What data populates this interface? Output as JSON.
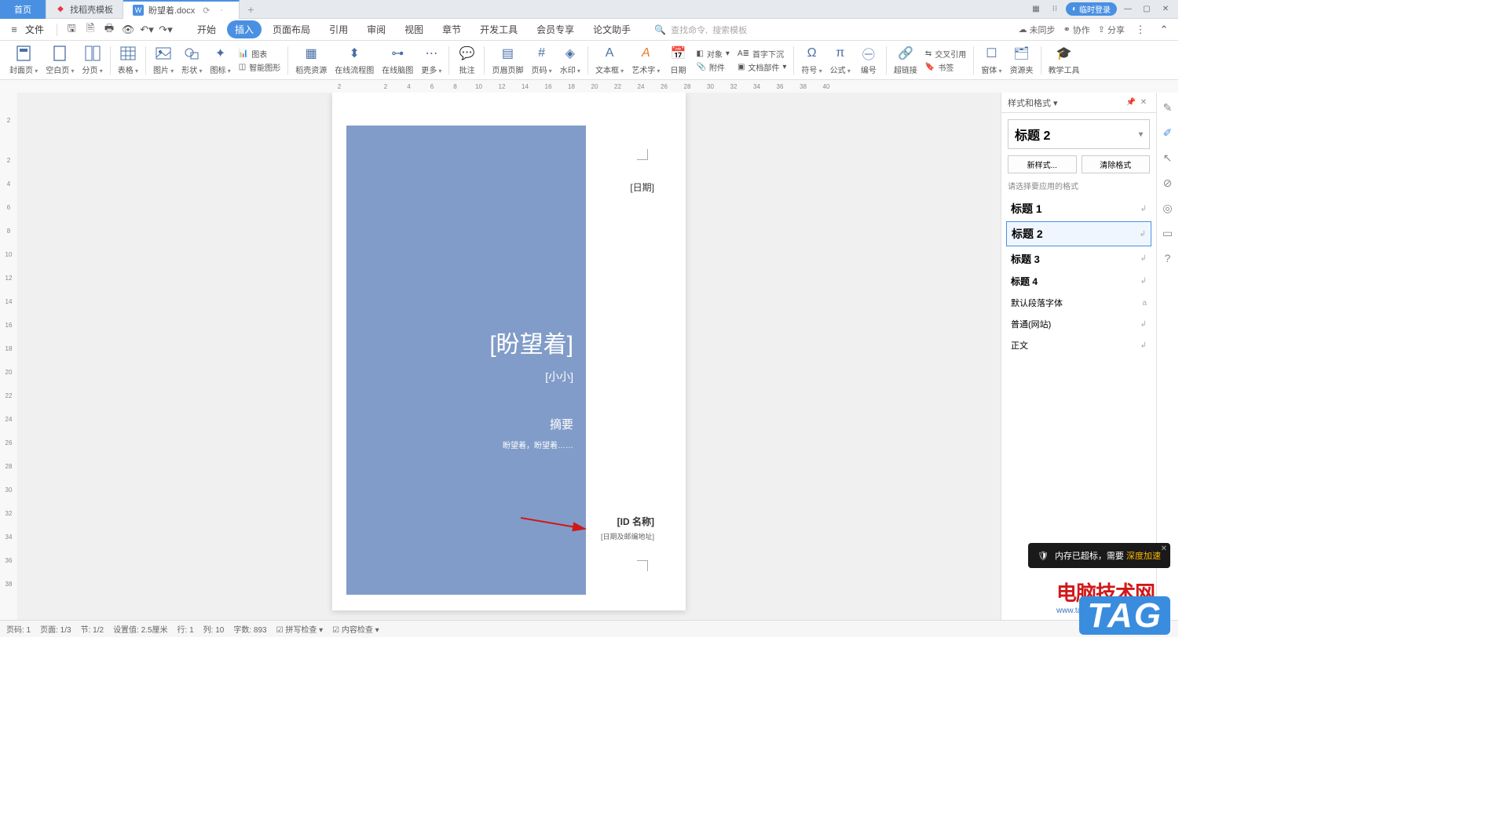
{
  "tabs": {
    "home": "首页",
    "t1": "找稻壳模板",
    "t2": "盼望着.docx"
  },
  "window": {
    "login": "临时登录"
  },
  "menubar": {
    "file": "文件",
    "tabs": [
      "开始",
      "插入",
      "页面布局",
      "引用",
      "审阅",
      "视图",
      "章节",
      "开发工具",
      "会员专享",
      "论文助手"
    ],
    "active_index": 1,
    "search_cmd": "查找命令,",
    "search_tpl": "搜索模板"
  },
  "right_actions": {
    "unsync": "未同步",
    "coop": "协作",
    "share": "分享"
  },
  "ribbon": {
    "cover": "封面页",
    "blank": "空白页",
    "break": "分页",
    "table": "表格",
    "pic": "图片",
    "shape": "形状",
    "icon": "图标",
    "chart": "图表",
    "smart": "智能图形",
    "daoke": "稻壳资源",
    "flow": "在线流程图",
    "mind": "在线脑图",
    "more": "更多",
    "comment": "批注",
    "header": "页眉页脚",
    "pageno": "页码",
    "watermark": "水印",
    "textbox": "文本框",
    "wordart": "艺术字",
    "date": "日期",
    "obj": "对象",
    "attach": "附件",
    "dropcap": "首字下沉",
    "docpart": "文档部件",
    "symbol": "符号",
    "formula": "公式",
    "number": "编号",
    "hyperlink": "超链接",
    "crossref": "交叉引用",
    "bookmark": "书签",
    "window": "窗体",
    "resource": "资源夹",
    "teach": "教学工具"
  },
  "ruler_h": [
    "2",
    "",
    "2",
    "4",
    "6",
    "8",
    "10",
    "12",
    "14",
    "16",
    "18",
    "20",
    "22",
    "24",
    "26",
    "28",
    "30",
    "32",
    "34",
    "36",
    "38",
    "40"
  ],
  "ruler_v": [
    "",
    "2",
    "",
    "2",
    "4",
    "6",
    "8",
    "10",
    "12",
    "14",
    "16",
    "18",
    "20",
    "22",
    "24",
    "26",
    "28",
    "30",
    "32",
    "34",
    "36",
    "38"
  ],
  "doc": {
    "date": "[日期]",
    "title": "[盼望着]",
    "subtitle": "[小小]",
    "abstract_h": "摘要",
    "abstract_b": "盼望着，盼望着……",
    "id_name": "[ID 名称]",
    "addr": "[日期及邮编地址]"
  },
  "styles_panel": {
    "title": "样式和格式",
    "current": "标题 2",
    "new_btn": "新样式...",
    "clear_btn": "清除格式",
    "hint": "请选择要应用的格式",
    "items": [
      {
        "name": "标题 1",
        "cls": ""
      },
      {
        "name": "标题 2",
        "cls": "",
        "selected": true
      },
      {
        "name": "标题 3",
        "cls": "h3"
      },
      {
        "name": "标题 4",
        "cls": "h4"
      },
      {
        "name": "默认段落字体",
        "cls": "normal",
        "mark": "a"
      },
      {
        "name": "普通(网站)",
        "cls": "normal"
      },
      {
        "name": "正文",
        "cls": "normal"
      }
    ]
  },
  "status": {
    "pg": "页码: 1",
    "pages": "页面: 1/3",
    "sec": "节: 1/2",
    "pos": "设置值: 2.5厘米",
    "line": "行: 1",
    "col": "列: 10",
    "words": "字数: 893",
    "spell": "拼写检查",
    "content": "内容检查"
  },
  "toast": {
    "text": "内存已超标，需要",
    "link": "深度加速"
  },
  "watermark": {
    "brand": "电脑技术网",
    "url": "www.tagxp.com",
    "tag": "TAG"
  }
}
